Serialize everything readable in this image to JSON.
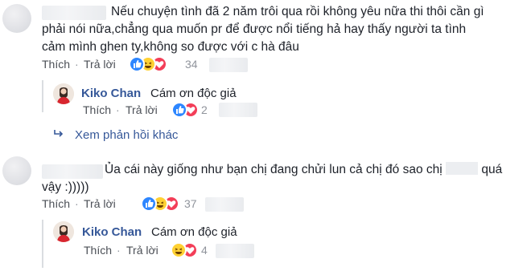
{
  "comments": [
    {
      "text": "Nếu chuyện tình đã 2 năm trôi qua rồi không yêu nữa thi thôi cần gì phải nói nữa,chẳng qua muốn pr để được nổi tiếng hả hay thấy người ta tình cảm mình ghen ty,không so được với c hà đâu",
      "like": "Thích",
      "reply": "Trả lời",
      "reaction_count": "34",
      "reply_item": {
        "name": "Kiko Chan",
        "text": "Cám ơn độc giả",
        "like": "Thích",
        "reply": "Trả lời",
        "reaction_count": "2"
      },
      "more_replies": "Xem phản hồi khác"
    },
    {
      "text_part1": "Ủa cái này giống như bạn chị đang chửi lun cả chị đó sao chị",
      "text_part2": "quá",
      "text_line2": "vậy :)))))",
      "like": "Thích",
      "reply": "Trả lời",
      "reaction_count": "37",
      "reply_item": {
        "name": "Kiko Chan",
        "text": "Cám ơn độc giả",
        "like": "Thích",
        "reply": "Trả lời",
        "reaction_count": "4"
      }
    }
  ],
  "separator": "·",
  "colors": {
    "link": "#365899",
    "text": "#1d2129",
    "meta": "#90949c"
  }
}
